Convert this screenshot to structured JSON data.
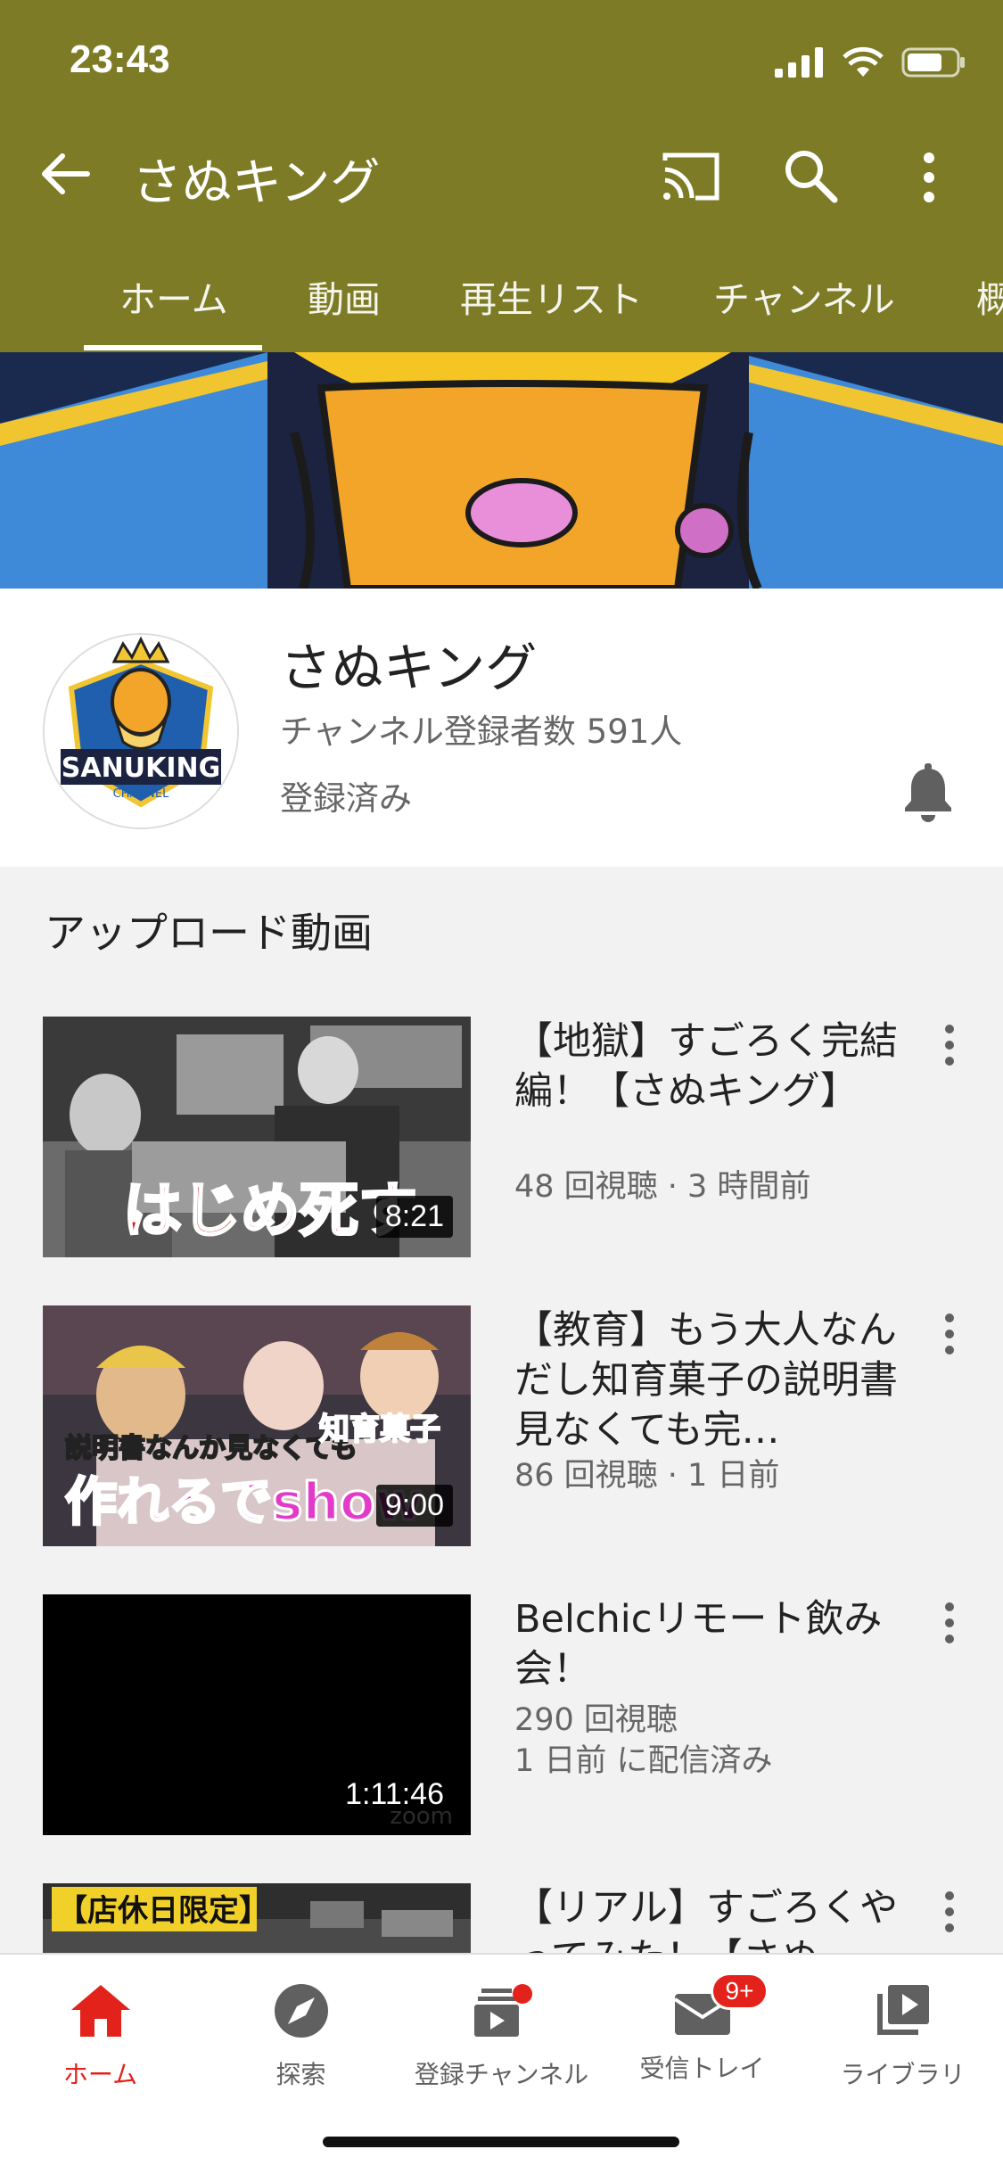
{
  "status_bar": {
    "time": "23:43"
  },
  "header": {
    "title": "さぬキング",
    "tabs": [
      {
        "label": "ホーム",
        "active": true
      },
      {
        "label": "動画"
      },
      {
        "label": "再生リスト"
      },
      {
        "label": "チャンネル"
      },
      {
        "label": "概"
      }
    ]
  },
  "channel": {
    "name": "さぬキング",
    "subscribers": "チャンネル登録者数 591人",
    "status": "登録済み",
    "logo_text_main": "SANUKING",
    "logo_text_sub": "CHANNEL"
  },
  "section": {
    "title": "アップロード動画"
  },
  "videos": [
    {
      "title": "【地獄】すごろく完結編！【さぬキング】",
      "meta": "48 回視聴 · 3 時間前",
      "duration": "8:21",
      "thumb_caption": "はじめ死す"
    },
    {
      "title": "【教育】もう大人なんだし知育菓子の説明書見なくても完…",
      "meta": "86 回視聴 · 1 日前",
      "duration": "9:00",
      "thumb_caption_top": "説明書なんか見なくても",
      "thumb_caption_right": "知育菓子",
      "thumb_caption_main": "作れるでshow"
    },
    {
      "title": "Belchicリモート飲み会！",
      "meta": "290 回視聴",
      "meta2": "1 日前 に配信済み",
      "duration": "1:11:46",
      "thumb_watermark": "zoom"
    },
    {
      "title": "【リアル】すごろくやってみた！【さぬ",
      "thumb_caption": "【店休日限定】"
    }
  ],
  "bottom_nav": {
    "items": [
      {
        "label": "ホーム",
        "icon": "home-icon",
        "active": true
      },
      {
        "label": "探索",
        "icon": "compass-icon"
      },
      {
        "label": "登録チャンネル",
        "icon": "subscriptions-icon"
      },
      {
        "label": "受信トレイ",
        "icon": "inbox-icon",
        "badge": "9+"
      },
      {
        "label": "ライブラリ",
        "icon": "library-icon"
      }
    ]
  },
  "colors": {
    "header": "#7d7b25",
    "accent": "#e3221b"
  }
}
